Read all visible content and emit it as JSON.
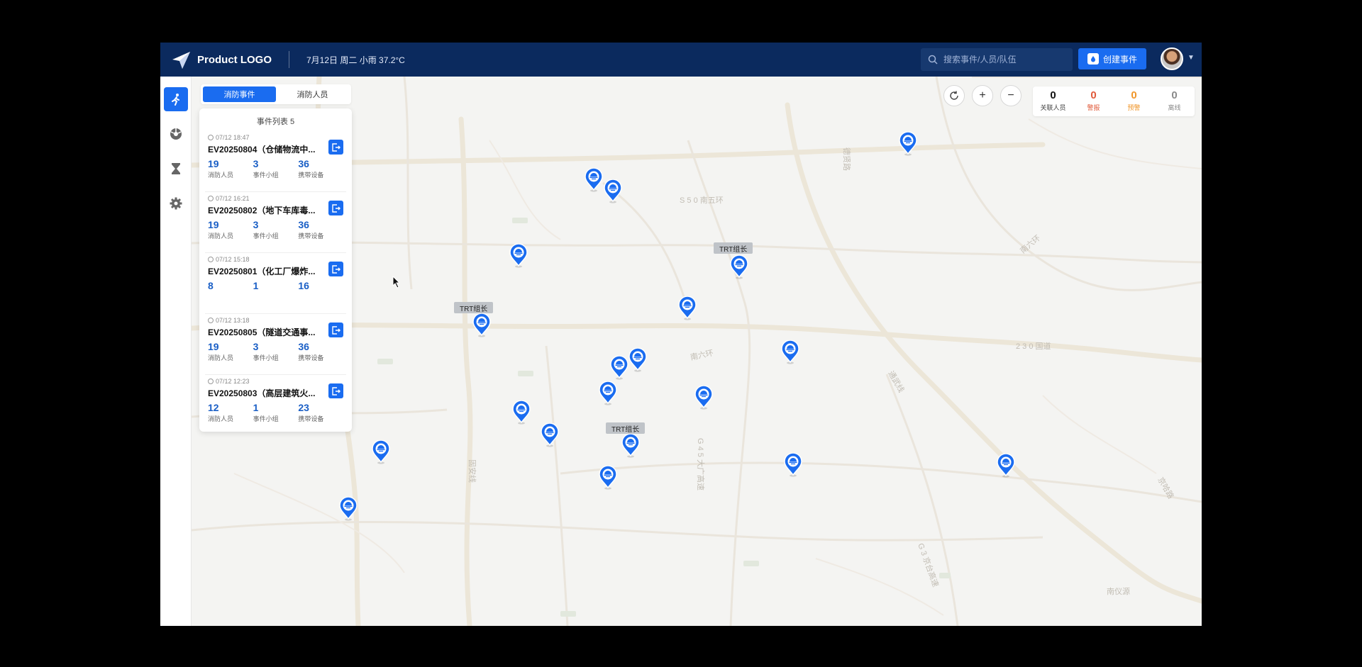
{
  "header": {
    "logo_text": "Product LOGO",
    "weather": "7月12日 周二 小雨 37.2°C",
    "search_placeholder": "搜索事件/人员/队伍",
    "create_label": "创建事件"
  },
  "tabs": [
    {
      "label": "消防事件",
      "active": true
    },
    {
      "label": "消防人员",
      "active": false
    }
  ],
  "panel": {
    "title": "事件列表 5",
    "events": [
      {
        "time": "07/12 18:47",
        "title": "EV20250804（仓储物流中...",
        "stats": [
          {
            "num": "19",
            "label": "消防人员"
          },
          {
            "num": "3",
            "label": "事件小组"
          },
          {
            "num": "36",
            "label": "携带设备"
          }
        ]
      },
      {
        "time": "07/12 16:21",
        "title": "EV20250802（地下车库毒...",
        "stats": [
          {
            "num": "19",
            "label": "消防人员"
          },
          {
            "num": "3",
            "label": "事件小组"
          },
          {
            "num": "36",
            "label": "携带设备"
          }
        ]
      },
      {
        "time": "07/12 15:18",
        "title": "EV20250801（化工厂爆炸...",
        "stats": [
          {
            "num": "8",
            "label": ""
          },
          {
            "num": "1",
            "label": ""
          },
          {
            "num": "16",
            "label": ""
          }
        ]
      },
      {
        "time": "07/12 13:18",
        "title": "EV20250805（隧道交通事...",
        "stats": [
          {
            "num": "19",
            "label": "消防人员"
          },
          {
            "num": "3",
            "label": "事件小组"
          },
          {
            "num": "36",
            "label": "携带设备"
          }
        ]
      },
      {
        "time": "07/12 12:23",
        "title": "EV20250803（高层建筑火...",
        "stats": [
          {
            "num": "12",
            "label": "消防人员"
          },
          {
            "num": "1",
            "label": "事件小组"
          },
          {
            "num": "23",
            "label": "携带设备"
          }
        ]
      }
    ]
  },
  "counters": [
    {
      "num": "0",
      "label": "关联人员",
      "color": "#111111"
    },
    {
      "num": "0",
      "label": "警报",
      "color": "#e05a3a"
    },
    {
      "num": "0",
      "label": "预警",
      "color": "#f0962a"
    },
    {
      "num": "0",
      "label": "离线",
      "color": "#8a8a8a"
    }
  ],
  "trt_labels": [
    "TRT组长",
    "TRT组长",
    "TRT组长"
  ],
  "map_labels": [
    "S 5 0 南五环",
    "南六环",
    "2 3 0 国道",
    "通武线",
    "G 4 5 大广高速",
    "南六环",
    "G 3 京台高速",
    "京哈路",
    "德贤路",
    "固安线",
    "南仪源"
  ],
  "colors": {
    "accent": "#1a6cf0",
    "header": "#0b2a5e"
  }
}
